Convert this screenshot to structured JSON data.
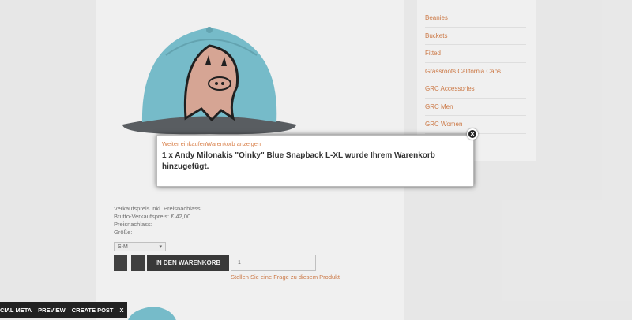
{
  "sidebar": {
    "items": [
      {
        "label": "Beanies"
      },
      {
        "label": "Buckets"
      },
      {
        "label": "Fitted"
      },
      {
        "label": "Grassroots California Caps"
      },
      {
        "label": "GRC Accessories"
      },
      {
        "label": "GRC Men"
      },
      {
        "label": "GRC Women"
      }
    ]
  },
  "product": {
    "price_info": "Verkaufspreis inkl. Preisnachlass:",
    "gross_price": "Brutto-Verkaufspreis: € 42,00",
    "discount": "Preisnachlass:",
    "size_label": "Größe:",
    "size_value": "S-M",
    "cart_button": "IN DEN WARENKORB",
    "quantity": "1",
    "question_link": "Stellen Sie eine Frage zu diesem Produkt"
  },
  "modal": {
    "continue_link": "Weiter einkaufen",
    "cart_link": "Warenkorb anzeigen",
    "message": "1 x Andy Milonakis \"Oinky\" Blue Snapback L-XL wurde Ihrem Warenkorb hinzugefügt.",
    "close_icon": "close-icon"
  },
  "admin_bar": {
    "social_meta": "CIAL META",
    "preview": "PREVIEW",
    "create_post": "CREATE POST",
    "close": "X"
  },
  "colors": {
    "link": "#d9814b",
    "cap_blue": "#7ec7d6",
    "cap_brim": "#5f6368",
    "ghost": "#e4b09e"
  }
}
